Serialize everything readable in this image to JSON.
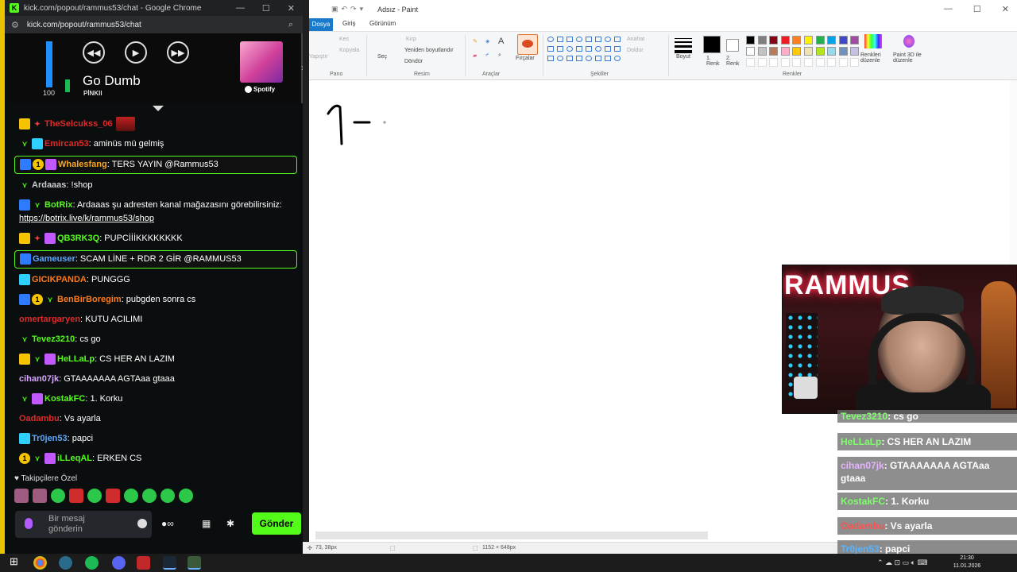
{
  "chrome": {
    "title": "kick.com/popout/rammus53/chat - Google Chrome",
    "url": "kick.com/popout/rammus53/chat",
    "controls": [
      "—",
      "☐",
      "✕"
    ]
  },
  "spotify": {
    "volume": 100,
    "volume_label": "100",
    "song": "Go Dumb",
    "artist": "PİNKII",
    "brand": "Spotify"
  },
  "chat": {
    "messages": [
      {
        "user": "TheSelcukss_06",
        "text": "",
        "user_color": "#e02a2a"
      },
      {
        "user": "Emircan53",
        "text": ": aminüs mü gelmiş",
        "user_color": "#e02a2a"
      },
      {
        "user": "Whalesfang",
        "text": ": TERS YAYIN @Rammus53",
        "user_color": "#f5a623",
        "highlight": true
      },
      {
        "user": "Ardaaas",
        "text": ": !shop",
        "user_color": "#c9c9c9"
      },
      {
        "user": "BotRix",
        "text": ": Ardaaas şu adresten kanal mağazasını görebilirsiniz: ",
        "link": "https://botrix.live/k/rammus53/shop",
        "user_color": "#53fc18"
      },
      {
        "user": "QB3RK3Q",
        "text": ": PUPCİİİKKKKKKKK",
        "user_color": "#53fc18"
      },
      {
        "user": "Gameuser",
        "text": ": SCAM LİNE + RDR 2 GİR @RAMMUS53",
        "user_color": "#5aa8ff",
        "highlight": true
      },
      {
        "user": "GICIKPANDA",
        "text": ": PUNGGG",
        "user_color": "#ff7a1a"
      },
      {
        "user": "BenBirBoregim",
        "text": ": pubgden sonra cs",
        "user_color": "#ff7a1a"
      },
      {
        "user": "omertargaryen",
        "text": ": KUTU ACILIMI",
        "user_color": "#e02a2a"
      },
      {
        "user": "Tevez3210",
        "text": ": cs go",
        "user_color": "#53fc18"
      },
      {
        "user": "HeLLaLp",
        "text": ": CS HER AN LAZIM",
        "user_color": "#53fc18"
      },
      {
        "user": "cihan07jk",
        "text": ": GTAAAAAAA AGTAaa gtaaa",
        "user_color": "#d8a6ff"
      },
      {
        "user": "KostakFC",
        "text": ": 1. Korku",
        "user_color": "#53fc18"
      },
      {
        "user": "Oadambu",
        "text": ": Vs ayarla",
        "user_color": "#e02a2a"
      },
      {
        "user": "Tr0jen53",
        "text": ": papci",
        "user_color": "#5aa8ff"
      },
      {
        "user": "iLLeqAL",
        "text": ": ERKEN CS",
        "user_color": "#53fc18"
      }
    ],
    "emote_section": "Takipçilere Özel",
    "composer_placeholder": "Bir mesaj gönderin",
    "send_label": "Gönder"
  },
  "paint": {
    "title": "Adsız - Paint",
    "tabs": [
      "Dosya",
      "Giriş",
      "Görünüm"
    ],
    "groups": {
      "clipboard": "Pano",
      "image": "Resim",
      "tools": "Araçlar",
      "shapes": "Şekiller",
      "colors": "Renkler"
    },
    "clipboard_items": [
      "Kes",
      "Kopyala",
      "Yapıştır"
    ],
    "image_items": [
      "Seç",
      "Kırp",
      "Yeniden boyutlandır",
      "Döndür"
    ],
    "brushes_label": "Fırçalar",
    "outline_label": "Anahat",
    "fill_label": "Doldur",
    "size_label": "Boyut",
    "color1_label": "1. Renk",
    "color2_label": "2. Renk",
    "edit_colors_label": "Renkleri düzenle",
    "paint3d_label": "Paint 3D ile düzenle",
    "palette": [
      "#000000",
      "#7f7f7f",
      "#880015",
      "#ed1c24",
      "#ff7f27",
      "#fff200",
      "#22b14c",
      "#00a2e8",
      "#3f48cc",
      "#a349a4",
      "#ffffff",
      "#c3c3c3",
      "#b97a57",
      "#ffaec9",
      "#ffc90e",
      "#efe4b0",
      "#b5e61d",
      "#99d9ea",
      "#7092be",
      "#c8bfe7"
    ],
    "status_pos": "73, 38px",
    "status_size": "1152 × 648px",
    "drawing_text": "1 -"
  },
  "overlay": {
    "messages": [
      {
        "user": "Tevez3210",
        "text": ": cs go"
      },
      {
        "user": "HeLLaLp",
        "text": ": CS HER AN LAZIM"
      },
      {
        "user": "cihan07jk",
        "text": ": GTAAAAAAA AGTAaa gtaaa"
      },
      {
        "user": "KostakFC",
        "text": ": 1. Korku"
      },
      {
        "user": "Oadambu",
        "text": ": Vs ayarla"
      },
      {
        "user": "Tr0jen53",
        "text": ": papci"
      }
    ],
    "cam_sign": "RAMMUS"
  },
  "taskbar": {
    "time": "21:30",
    "date": "11.01.2026"
  }
}
